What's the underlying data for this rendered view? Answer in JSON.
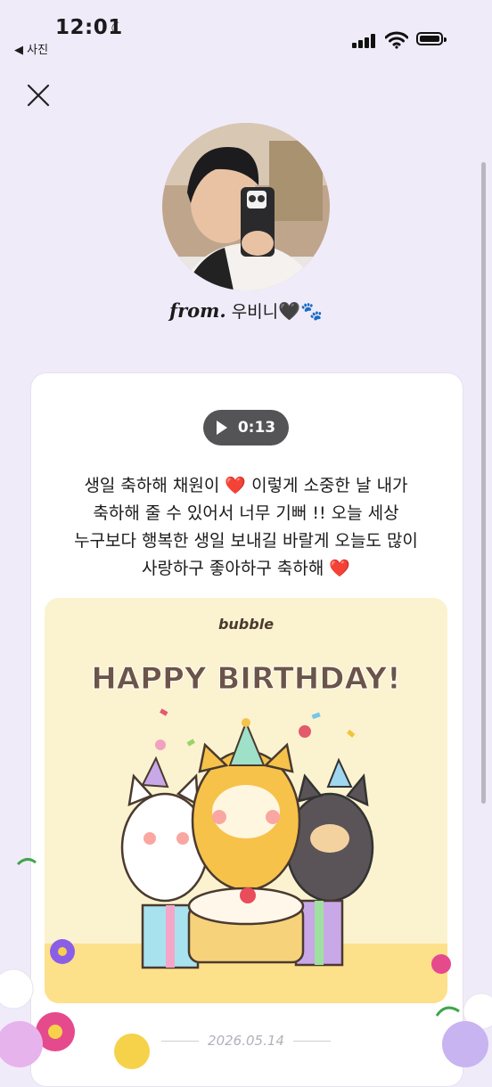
{
  "status_bar": {
    "time": "12:01",
    "back_label": "◀ 사진"
  },
  "profile": {
    "from_label": "from.",
    "name": "우비니",
    "emoji": "🖤🐾"
  },
  "audio": {
    "duration": "0:13"
  },
  "message": {
    "lines": [
      "생일 축하해 채원이 ❤️  이렇게 소중한 날 내가",
      "축하해 줄 수 있어서 너무 기뻐 !! 오늘 세상",
      "누구보다 행복한 생일 보내길 바랄게 오늘도 많이",
      "사랑하구 좋아하구 축하해 ❤️"
    ]
  },
  "birthday_card": {
    "brand": "bubble",
    "headline": "HAPPY BIRTHDAY!",
    "colors": {
      "background": "#fbf3cf",
      "headline": "#6b5448",
      "floor": "#fde08a"
    }
  },
  "date": "2026.05.14",
  "colors": {
    "page_background": "#f0ebf9",
    "card_background": "#ffffff",
    "audio_pill": "#545356"
  }
}
